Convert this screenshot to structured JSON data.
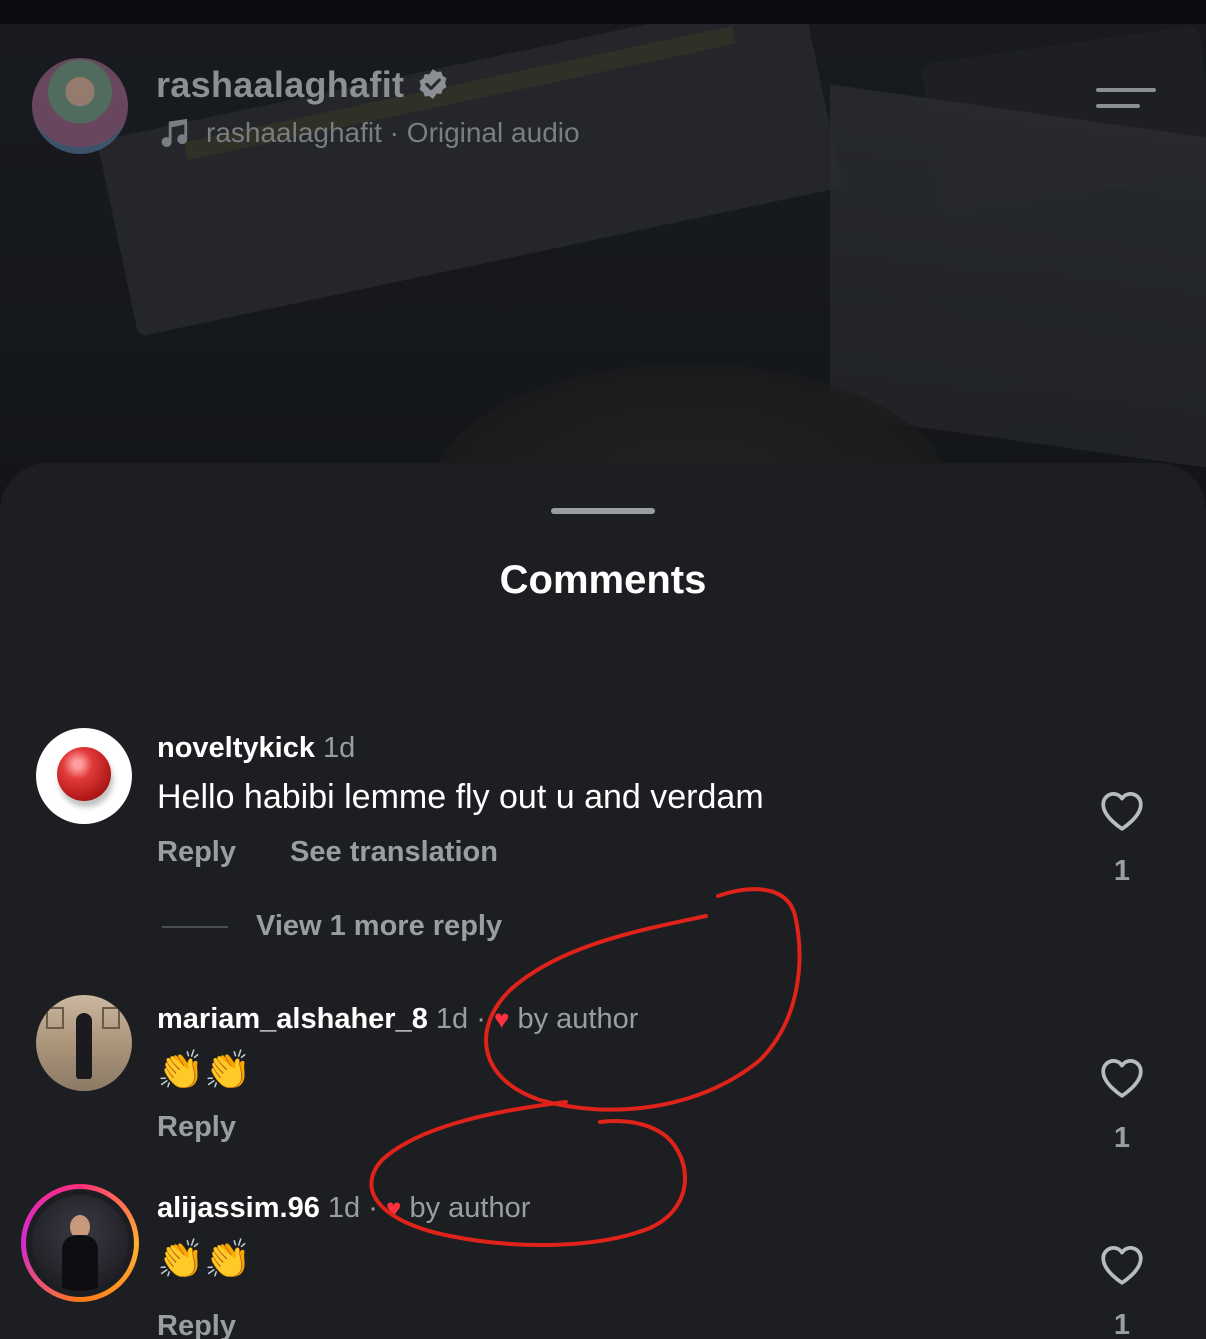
{
  "reel": {
    "username": "rashaalaghafit",
    "audio": "rashaalaghafit · Original audio"
  },
  "sheet": {
    "title": "Comments"
  },
  "comments": [
    {
      "username": "noveltykick",
      "time": "1d",
      "text": "Hello habibi lemme fly out u and verdam",
      "reply_label": "Reply",
      "translate_label": "See translation",
      "likes": "1",
      "view_replies": "View 1 more reply"
    },
    {
      "username": "mariam_alshaher_8",
      "time": "1d",
      "separator": "·",
      "liked_by": "by author",
      "text": "👏👏",
      "reply_label": "Reply",
      "likes": "1"
    },
    {
      "username": "alijassim.96",
      "time": "1d",
      "separator": "·",
      "liked_by": "by author",
      "text": "👏👏",
      "reply_label": "Reply",
      "likes": "1"
    }
  ],
  "colors": {
    "sheet_bg": "#1c1e22",
    "secondary_text": "#9a9da2",
    "heart_red": "#ff3040",
    "annotation_red": "#e0231a"
  },
  "icons": [
    "verified-badge-icon",
    "music-note-icon",
    "menu-icon",
    "heart-outline-icon",
    "heart-filled-icon"
  ]
}
